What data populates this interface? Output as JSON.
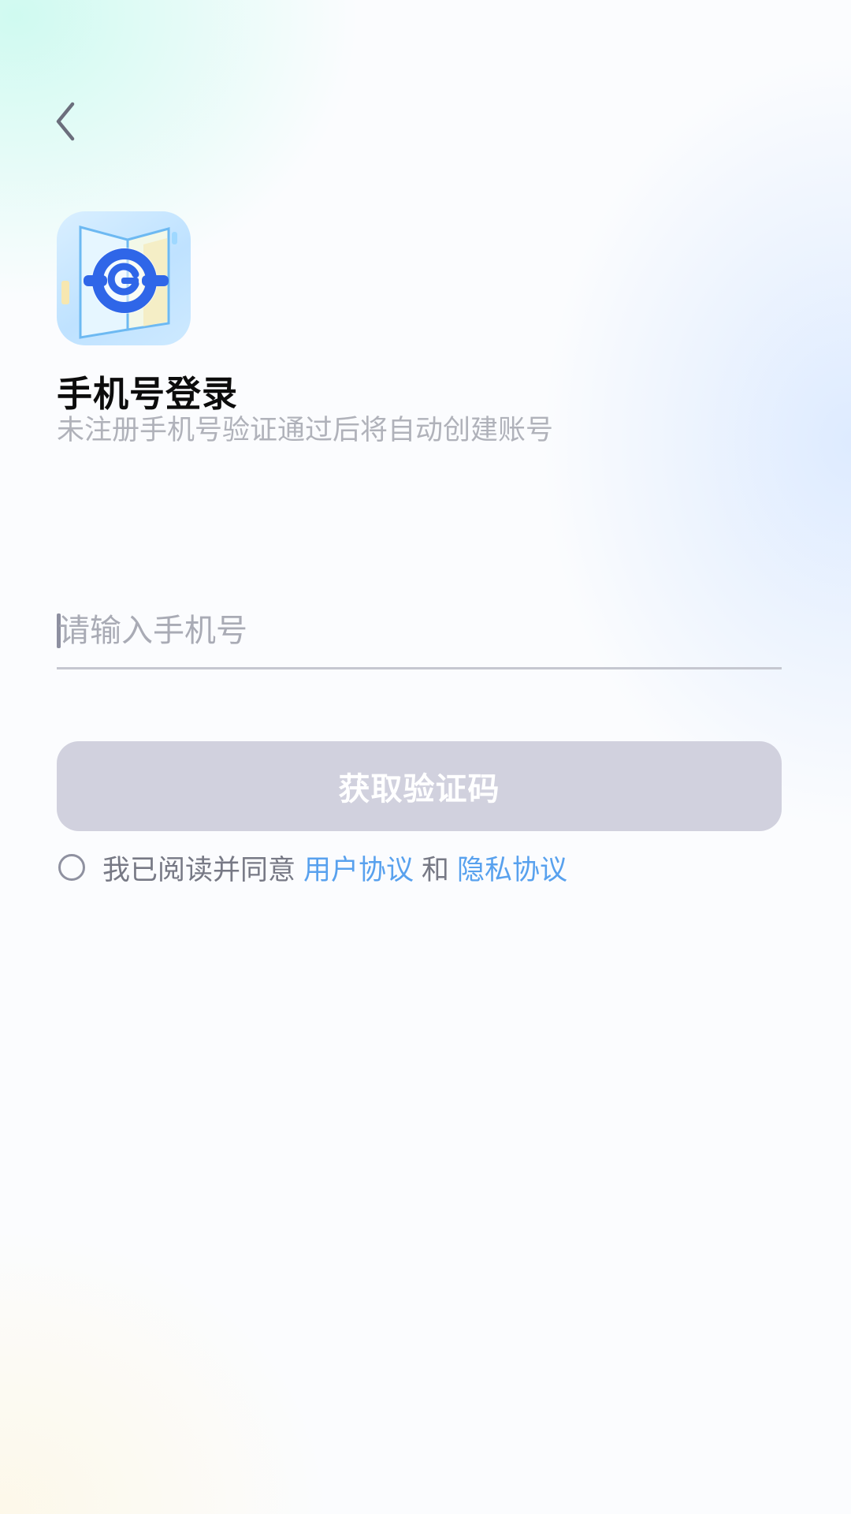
{
  "header": {
    "back_icon": "chevron-left-icon"
  },
  "logo": {
    "icon": "app-logo-icon",
    "colors": {
      "background": "#cfe8ff",
      "ring": "#2f66e8"
    }
  },
  "login": {
    "title": "手机号登录",
    "subtitle": "未注册手机号验证通过后将自动创建账号",
    "phone_value": "",
    "phone_placeholder": "请输入手机号",
    "get_code_label": "获取验证码"
  },
  "agreement": {
    "checked": false,
    "prefix": "我已阅读并同意",
    "user_agreement": "用户协议",
    "conjunction": "和",
    "privacy_agreement": "隐私协议"
  },
  "colors": {
    "button_disabled": "#d1d1de",
    "link": "#58a1ee",
    "subtitle": "#b0b2ba"
  }
}
